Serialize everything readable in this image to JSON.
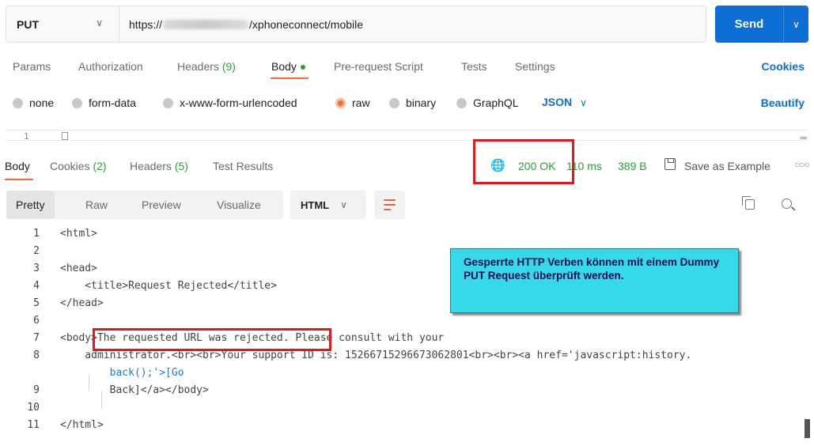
{
  "request": {
    "method": "PUT",
    "url_prefix": "https://",
    "url_suffix": "/xphoneconnect/mobile",
    "send_label": "Send"
  },
  "request_tabs": {
    "params": "Params",
    "authorization": "Authorization",
    "headers_label": "Headers",
    "headers_count": "(9)",
    "body": "Body",
    "pre_request": "Pre-request Script",
    "tests": "Tests",
    "settings": "Settings",
    "cookies": "Cookies"
  },
  "body_types": {
    "none": "none",
    "form_data": "form-data",
    "urlencoded": "x-www-form-urlencoded",
    "raw": "raw",
    "binary": "binary",
    "graphql": "GraphQL",
    "format": "JSON",
    "beautify": "Beautify",
    "selected": "raw"
  },
  "request_editor": {
    "line": "1"
  },
  "response_tabs": {
    "body": "Body",
    "cookies_label": "Cookies",
    "cookies_count": "(2)",
    "headers_label": "Headers",
    "headers_count": "(5)",
    "test_results": "Test Results"
  },
  "response_meta": {
    "status": "200 OK",
    "time": "110 ms",
    "size": "389 B",
    "save_example": "Save as Example"
  },
  "view_modes": {
    "pretty": "Pretty",
    "raw": "Raw",
    "preview": "Preview",
    "visualize": "Visualize",
    "language": "HTML"
  },
  "code_lines": [
    {
      "n": "1",
      "text": "<html>"
    },
    {
      "n": "2",
      "text": ""
    },
    {
      "n": "3",
      "text": "<head>"
    },
    {
      "n": "4",
      "text": "    <title>Request Rejected</title>"
    },
    {
      "n": "5",
      "text": "</head>"
    },
    {
      "n": "6",
      "text": ""
    },
    {
      "n": "7",
      "text": "<body>The requested URL was rejected. Please consult with your"
    },
    {
      "n": "8",
      "text": "    administrator.<br><br>Your support ID is: 15266715296673062801<br><br><a href='javascript:history."
    },
    {
      "n": "",
      "text": "        back();'>[Go"
    },
    {
      "n": "9",
      "text": "        Back]</a></body>"
    },
    {
      "n": "10",
      "text": ""
    },
    {
      "n": "11",
      "text": "</html>"
    }
  ],
  "callout": {
    "text": "Gesperrte HTTP Verben können mit einem Dummy PUT Request überprüft werden."
  },
  "colors": {
    "accent": "#0d6fd6",
    "active_tab": "#ff6c37",
    "success": "#2a9d3a",
    "callout_bg": "#35d9ea",
    "highlight_box": "#e01a1a"
  }
}
